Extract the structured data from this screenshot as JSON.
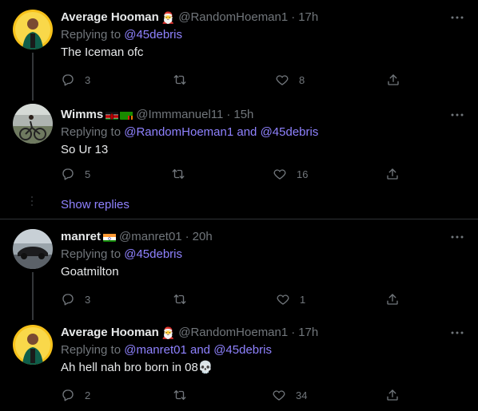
{
  "tweets": [
    {
      "name": "Average Hooman",
      "emoji": "🎅",
      "handle": "@RandomHoeman1",
      "dot": "·",
      "time": "17h",
      "replying_prefix": "Replying to ",
      "replying_to": "@45debris",
      "replying_joiner": "",
      "replying_to_2": "",
      "text": "The Iceman ofc",
      "replies": "3",
      "retweets": "",
      "likes": "8"
    },
    {
      "name": "Wimms",
      "emoji": "",
      "handle": "@Immmanuel11",
      "dot": "·",
      "time": "15h",
      "replying_prefix": "Replying to ",
      "replying_to": "@RandomHoeman1",
      "replying_joiner": " and ",
      "replying_to_2": "@45debris",
      "text": "So Ur 13",
      "replies": "5",
      "retweets": "",
      "likes": "16"
    },
    {
      "name": "manret",
      "emoji": "",
      "handle": "@manret01",
      "dot": "·",
      "time": "20h",
      "replying_prefix": "Replying to ",
      "replying_to": "@45debris",
      "replying_joiner": "",
      "replying_to_2": "",
      "text": "Goatmilton",
      "replies": "3",
      "retweets": "",
      "likes": "1"
    },
    {
      "name": "Average Hooman",
      "emoji": "🎅",
      "handle": "@RandomHoeman1",
      "dot": "·",
      "time": "17h",
      "replying_prefix": "Replying to ",
      "replying_to": "@manret01",
      "replying_joiner": " and ",
      "replying_to_2": "@45debris",
      "text": "Ah hell nah bro born in 08",
      "text_emoji": "💀",
      "replies": "2",
      "retweets": "",
      "likes": "34"
    }
  ],
  "show_replies": "Show replies",
  "more_glyph": "···",
  "colors": {
    "background": "#000000",
    "link": "#8f82ff",
    "muted": "#71767b",
    "divider": "#2f3336"
  }
}
